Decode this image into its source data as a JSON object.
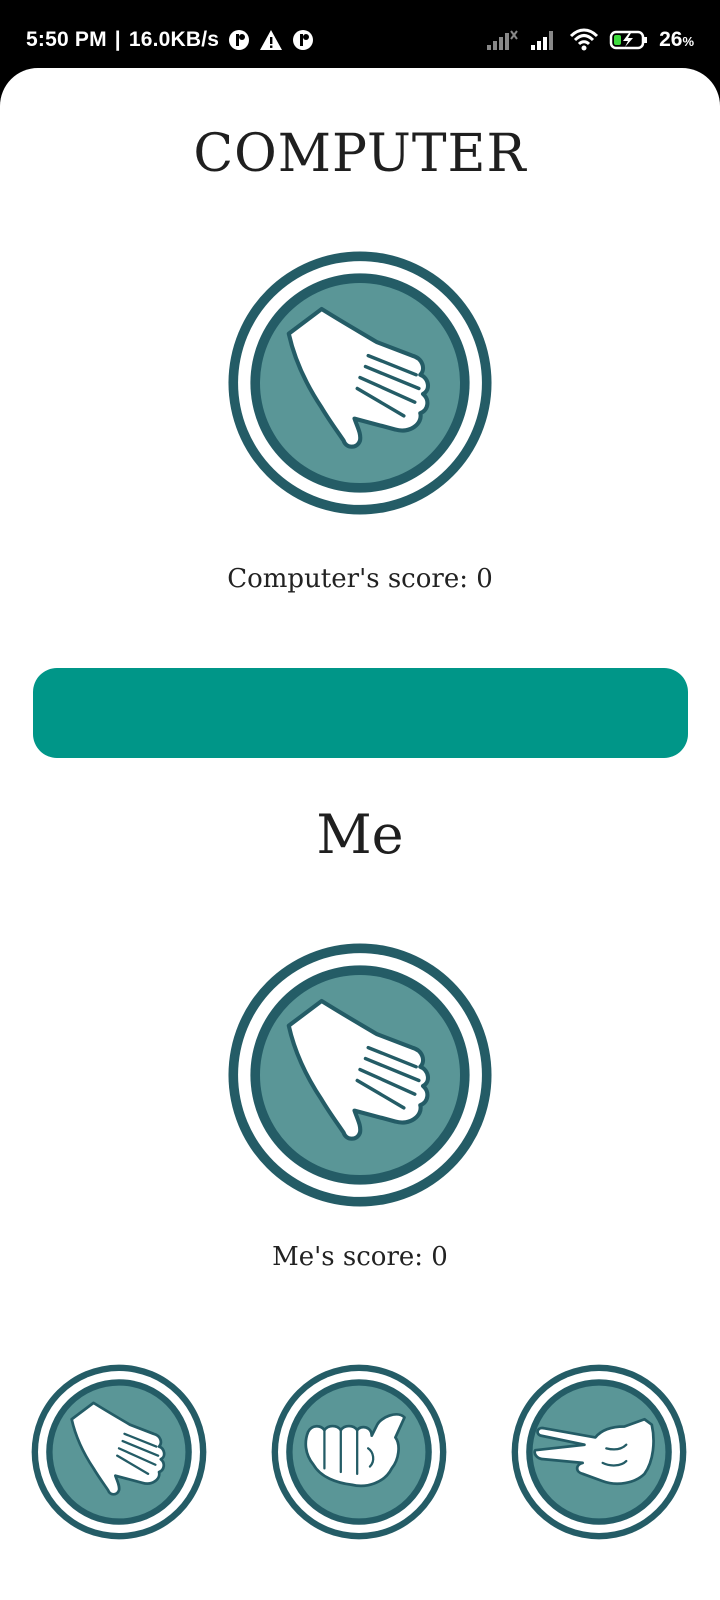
{
  "status_bar": {
    "time": "5:50 PM",
    "net_speed": "16.0KB/s",
    "battery_percent": "26",
    "battery_unit": "%",
    "icons": [
      "notification-icon",
      "alert-icon",
      "notification-icon",
      "signal-icon",
      "signal-icon",
      "wifi-icon",
      "battery-charging-icon"
    ]
  },
  "game": {
    "computer_title": "COMPUTER",
    "computer_score_label": "Computer's score: 0",
    "me_title": "Me",
    "me_score_label": "Me's score: 0",
    "computer_choice": "paper-hand-icon",
    "me_choice": "paper-hand-icon",
    "choices": [
      "paper-hand-icon",
      "rock-fist-icon",
      "scissors-hand-icon"
    ]
  },
  "colors": {
    "accent": "#009688",
    "ring_dark": "#245c66",
    "ring_fill": "#5a9697",
    "text": "#1f1f1f",
    "status_bg": "#000000"
  }
}
